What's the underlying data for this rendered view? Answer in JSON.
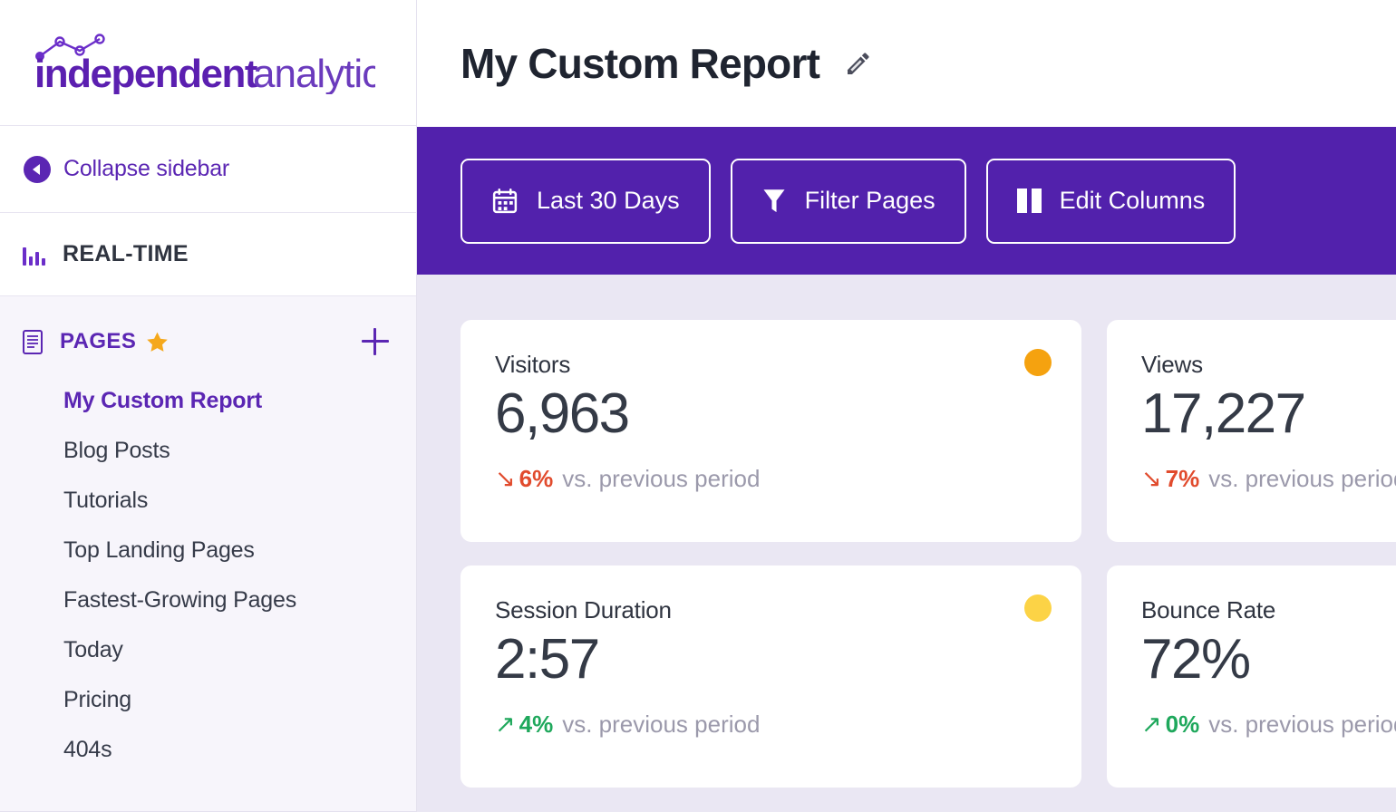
{
  "brand": {
    "logo_text_bold": "independent",
    "logo_text_light": " analytics",
    "accent_purple": "#5b26b3",
    "toolbar_purple": "#5221ac"
  },
  "sidebar": {
    "collapse": {
      "label": "Collapse sidebar",
      "icon": "chevron-left-circle-icon"
    },
    "realtime": {
      "label": "REAL-TIME",
      "icon": "bar-chart-icon"
    },
    "pages_section": {
      "title": "PAGES",
      "icon": "document-icon",
      "star_icon": "star-icon",
      "add_icon": "plus-icon",
      "items": [
        {
          "label": "My Custom Report",
          "active": true
        },
        {
          "label": "Blog Posts",
          "active": false
        },
        {
          "label": "Tutorials",
          "active": false
        },
        {
          "label": "Top Landing Pages",
          "active": false
        },
        {
          "label": "Fastest-Growing Pages",
          "active": false
        },
        {
          "label": "Today",
          "active": false
        },
        {
          "label": "Pricing",
          "active": false
        },
        {
          "label": "404s",
          "active": false
        }
      ]
    }
  },
  "header": {
    "title": "My Custom Report",
    "edit_icon": "pencil-icon"
  },
  "toolbar": {
    "buttons": [
      {
        "label": "Last 30 Days",
        "icon": "calendar-icon"
      },
      {
        "label": "Filter Pages",
        "icon": "funnel-icon"
      },
      {
        "label": "Edit Columns",
        "icon": "columns-icon"
      }
    ]
  },
  "stats": {
    "compare_text": "vs. previous period",
    "cards": [
      {
        "label": "Visitors",
        "value": "6,963",
        "delta": "6%",
        "direction": "down",
        "arrow": "↘",
        "dot_color": "#f5a20f"
      },
      {
        "label": "Views",
        "value": "17,227",
        "delta": "7%",
        "direction": "down",
        "arrow": "↘",
        "dot_color": "#f5a20f"
      },
      {
        "label": "Session Duration",
        "value": "2:57",
        "delta": "4%",
        "direction": "up",
        "arrow": "↗",
        "dot_color": "#fcd346"
      },
      {
        "label": "Bounce Rate",
        "value": "72%",
        "delta": "0%",
        "direction": "up",
        "arrow": "↗",
        "dot_color": "#fcd346"
      }
    ]
  }
}
